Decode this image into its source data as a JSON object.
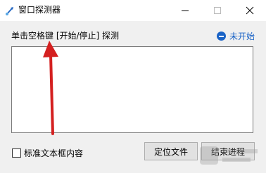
{
  "window": {
    "title": "窗口探测器"
  },
  "titlebar": {
    "minimize_icon": "minimize-icon",
    "maximize_icon": "maximize-icon",
    "close_icon": "close-icon"
  },
  "hint": {
    "text": "单击空格键 [开始/停止] 探测"
  },
  "status": {
    "text": "未开始",
    "icon": "stop-circle-icon",
    "color": "#1a63c6"
  },
  "results": {
    "value": ""
  },
  "options": {
    "checkbox_label": "标准文本框内容",
    "checked": false
  },
  "buttons": {
    "locate": "定位文件",
    "end": "结束进程"
  },
  "annotation": {
    "arrow_color": "#d42020"
  }
}
